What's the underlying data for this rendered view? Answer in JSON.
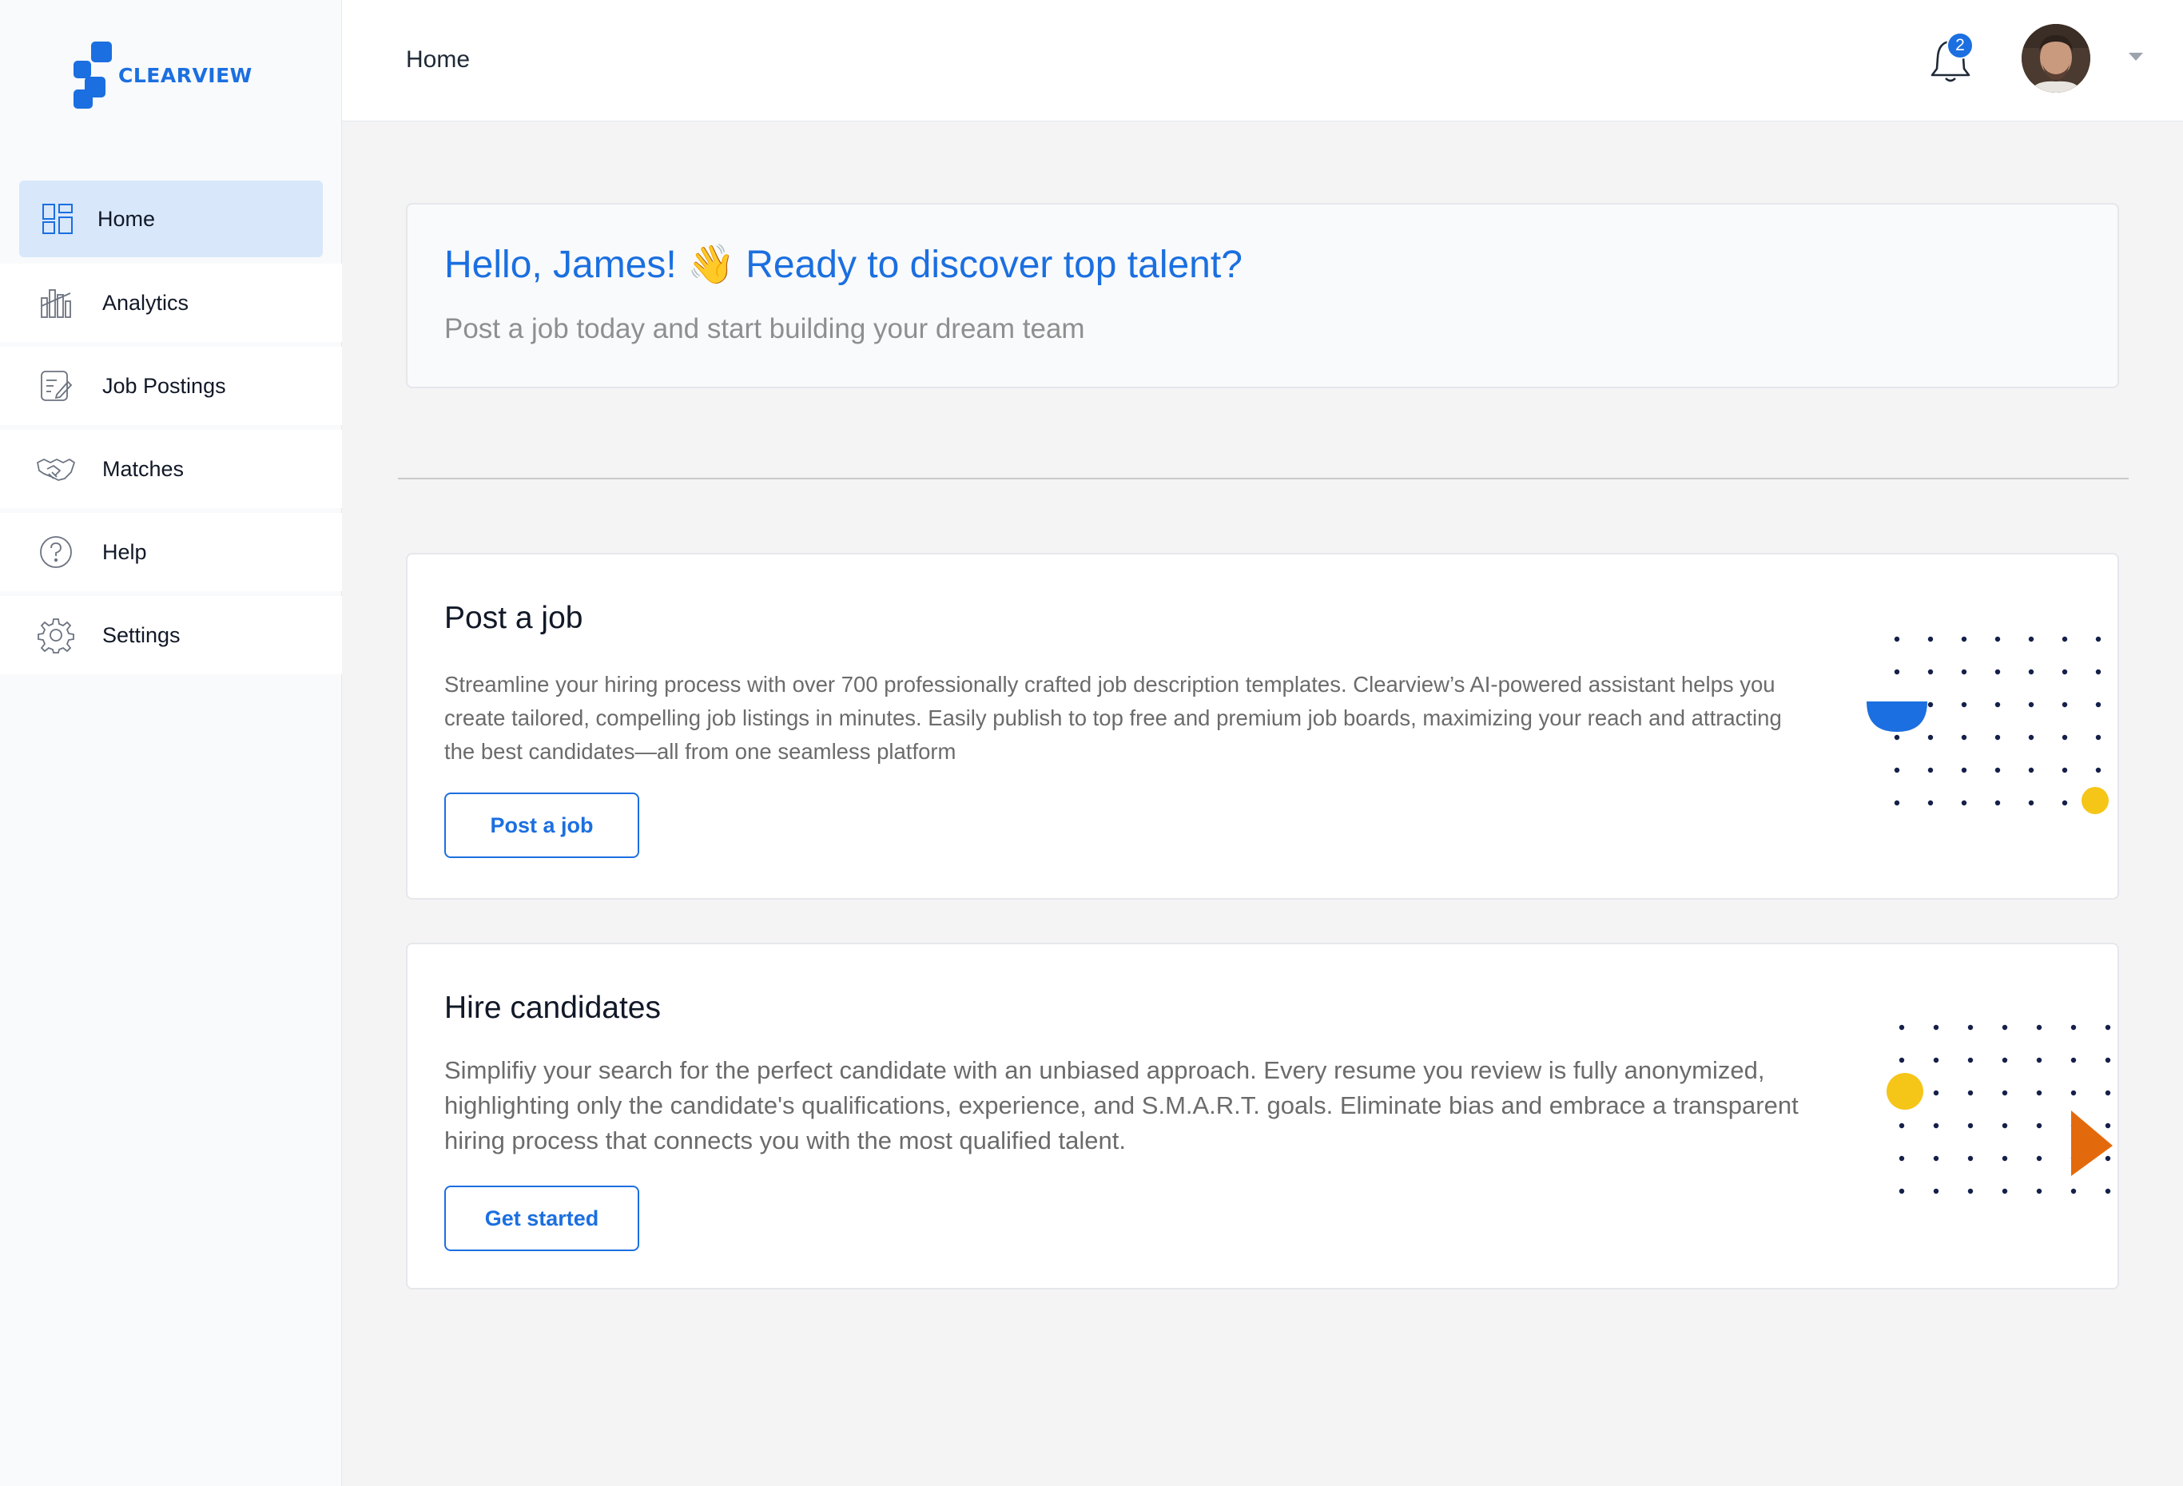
{
  "app": {
    "logo_text": "CLEARVIEW"
  },
  "sidebar": {
    "items": [
      {
        "label": "Home",
        "icon": "dashboard-icon",
        "active": true
      },
      {
        "label": "Analytics",
        "icon": "analytics-icon",
        "active": false
      },
      {
        "label": "Job Postings",
        "icon": "edit-document-icon",
        "active": false
      },
      {
        "label": "Matches",
        "icon": "handshake-icon",
        "active": false
      },
      {
        "label": "Help",
        "icon": "help-icon",
        "active": false
      },
      {
        "label": "Settings",
        "icon": "gear-icon",
        "active": false
      }
    ]
  },
  "header": {
    "title": "Home",
    "notification_count": "2",
    "icons": [
      "bell-icon",
      "avatar",
      "chevron-down-icon"
    ]
  },
  "greeting": {
    "title": "Hello, James! 👋 Ready to discover top talent?",
    "subtitle": "Post a job today and start building your dream team"
  },
  "cards": [
    {
      "title": "Post a job",
      "description": "Streamline your hiring process with over 700 professionally crafted job description templates. Clearview’s AI-powered assistant helps you create tailored, compelling job listings in minutes. Easily publish to top free and premium job boards, maximizing your reach and attracting the best candidates—all from one seamless platform",
      "button_label": "Post a job"
    },
    {
      "title": "Hire candidates",
      "description": "Simplifiy your search for the perfect candidate with an unbiased approach. Every resume you review is fully anonymized, highlighting only the candidate's qualifications, experience, and S.M.A.R.T. goals. Eliminate bias and embrace a transparent hiring process that connects you with the most qualified talent.",
      "button_label": "Get started"
    }
  ],
  "colors": {
    "brand": "#1b6fe0",
    "active_nav": "#d9e7fb",
    "accent_yellow": "#f5c518",
    "accent_orange": "#e36a0c",
    "dot_navy": "#15204a"
  }
}
